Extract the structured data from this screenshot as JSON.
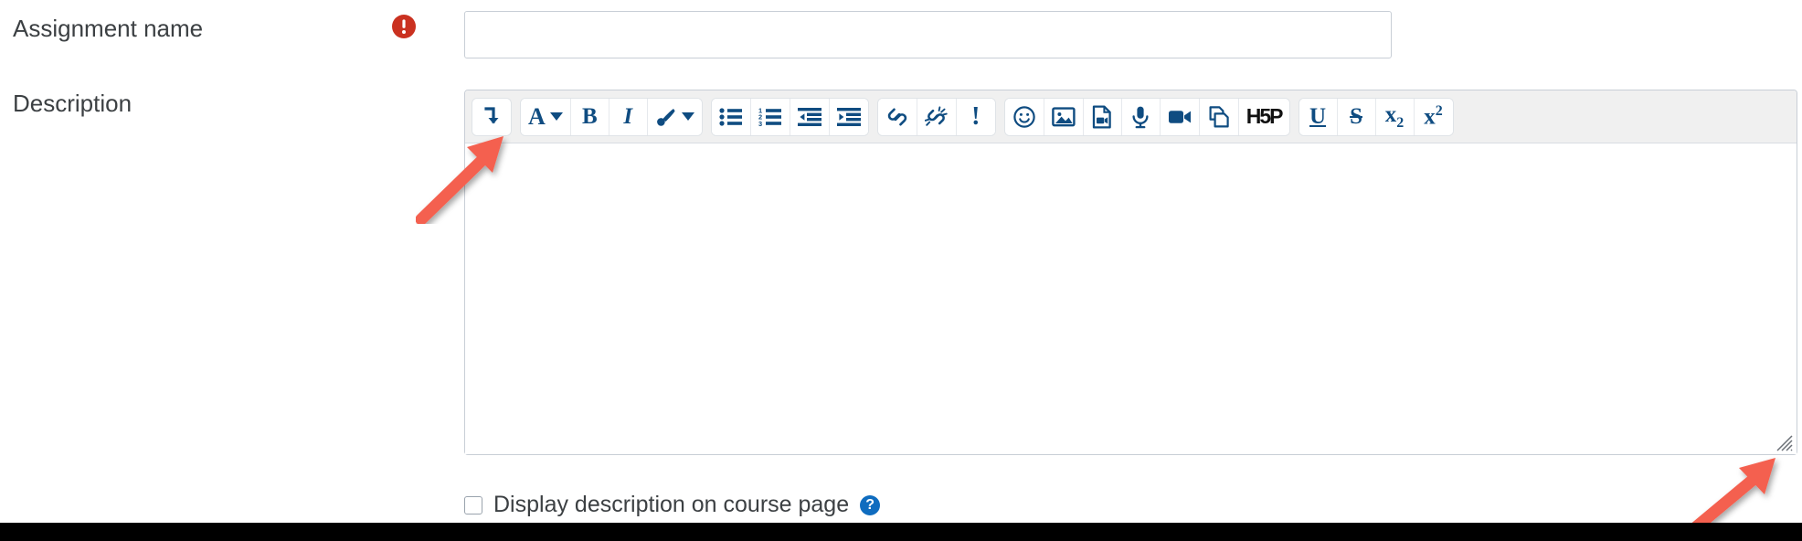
{
  "form": {
    "fields": [
      {
        "id": "assignment-name",
        "label": "Assignment name",
        "required": true,
        "required_icon": "exclamation-circle-icon",
        "value": "",
        "placeholder": ""
      },
      {
        "id": "description",
        "label": "Description",
        "required": false,
        "value": "",
        "placeholder": ""
      }
    ]
  },
  "editor": {
    "content": "",
    "resize_grip_icon": "resize-grip-icon",
    "toolbar_groups": [
      {
        "name": "expand",
        "buttons": [
          {
            "name": "collapse-toolbar-button",
            "icon": "arrow-down-hook-icon",
            "label": ""
          }
        ]
      },
      {
        "name": "text-style",
        "buttons": [
          {
            "name": "style-button",
            "icon": "letter-a-icon",
            "label": "A",
            "has_caret": true
          },
          {
            "name": "bold-button",
            "icon": "bold-icon",
            "label": "B"
          },
          {
            "name": "italic-button",
            "icon": "italic-icon",
            "label": "I"
          },
          {
            "name": "highlight-button",
            "icon": "paintbrush-icon",
            "label": "",
            "has_caret": true
          }
        ]
      },
      {
        "name": "lists-indent",
        "buttons": [
          {
            "name": "bullet-list-button",
            "icon": "bullet-list-icon",
            "label": ""
          },
          {
            "name": "numbered-list-button",
            "icon": "numbered-list-icon",
            "label": ""
          },
          {
            "name": "outdent-button",
            "icon": "outdent-icon",
            "label": ""
          },
          {
            "name": "indent-button",
            "icon": "indent-icon",
            "label": ""
          }
        ]
      },
      {
        "name": "links",
        "buttons": [
          {
            "name": "link-button",
            "icon": "link-icon",
            "label": ""
          },
          {
            "name": "unlink-button",
            "icon": "unlink-icon",
            "label": ""
          },
          {
            "name": "accessibility-checker-button",
            "icon": "exclamation-mark-icon",
            "label": "!"
          }
        ]
      },
      {
        "name": "media",
        "buttons": [
          {
            "name": "emoji-button",
            "icon": "smiley-face-icon",
            "label": ""
          },
          {
            "name": "insert-image-button",
            "icon": "image-icon",
            "label": ""
          },
          {
            "name": "insert-media-button",
            "icon": "media-file-icon",
            "label": ""
          },
          {
            "name": "record-audio-button",
            "icon": "microphone-icon",
            "label": ""
          },
          {
            "name": "record-video-button",
            "icon": "video-camera-icon",
            "label": ""
          },
          {
            "name": "manage-files-button",
            "icon": "copy-files-icon",
            "label": ""
          },
          {
            "name": "h5p-button",
            "icon": "h5p-icon",
            "label": "H5P"
          }
        ]
      },
      {
        "name": "text-decoration",
        "buttons": [
          {
            "name": "underline-button",
            "icon": "underline-icon",
            "label": "U"
          },
          {
            "name": "strikethrough-button",
            "icon": "strikethrough-icon",
            "label": "S"
          },
          {
            "name": "subscript-button",
            "icon": "subscript-icon",
            "label": "x",
            "sub": "2"
          },
          {
            "name": "superscript-button",
            "icon": "superscript-icon",
            "label": "x",
            "sup": "2"
          }
        ]
      }
    ]
  },
  "display_description": {
    "checked": false,
    "label": "Display description on course page",
    "help_label": "?",
    "help_icon": "help-circle-icon"
  },
  "annotations": [
    {
      "name": "arrow-to-collapse-toolbar-button",
      "color": "#f4604f"
    },
    {
      "name": "arrow-to-resize-grip",
      "color": "#f4604f"
    }
  ],
  "colors": {
    "toolbar_icon": "#0f4c81",
    "required_badge": "#ca3120",
    "help_badge": "#0f6cbf",
    "annotation_arrow": "#f4604f",
    "border": "#c8ced6",
    "toolbar_bg": "#f0f0f0"
  }
}
